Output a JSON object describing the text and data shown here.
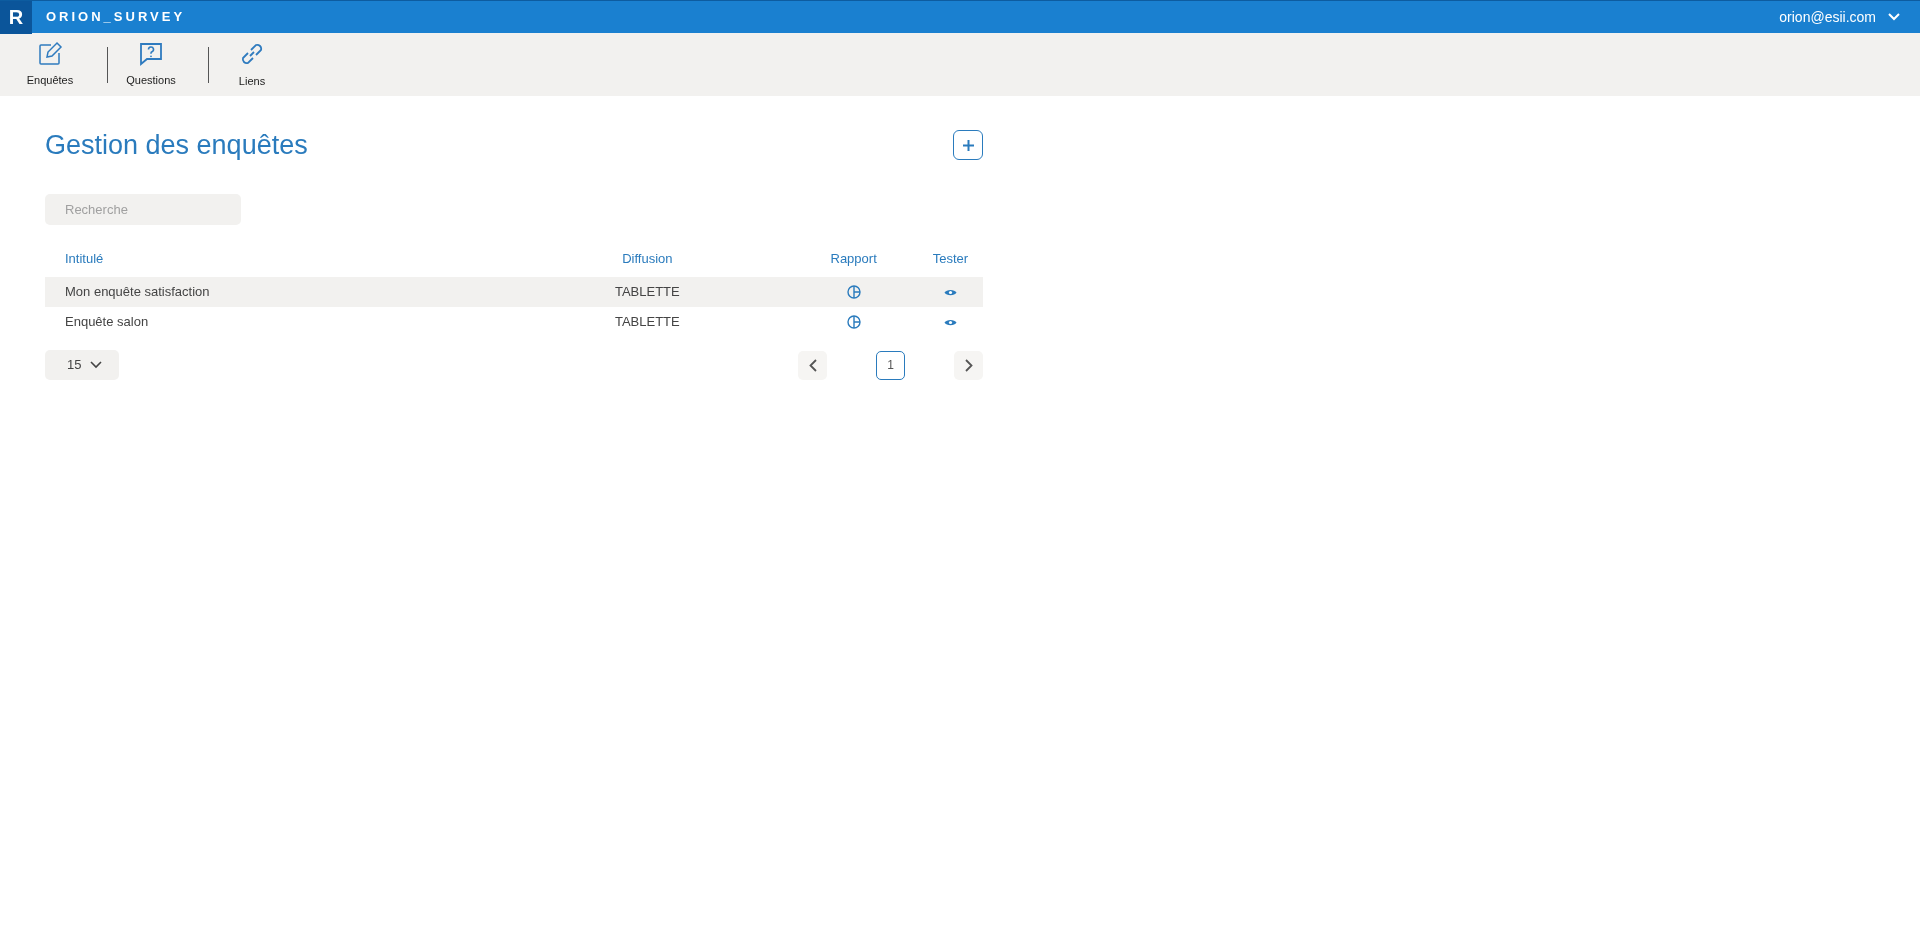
{
  "header": {
    "logo": "R",
    "brand": "ORION_SURVEY",
    "user": "orion@esii.com"
  },
  "toolbar": [
    {
      "label": "Enquêtes",
      "kind": "edit"
    },
    {
      "label": "Questions",
      "kind": "question"
    },
    {
      "label": "Liens",
      "kind": "link"
    }
  ],
  "page": {
    "title": "Gestion des enquêtes",
    "search": {
      "placeholder": "Recherche"
    }
  },
  "table": {
    "columns": [
      "Intitulé",
      "Diffusion",
      "Rapport",
      "Tester"
    ],
    "rows": [
      {
        "title": "Mon enquête satisfaction",
        "diffusion": "TABLETTE",
        "highlighted": true
      },
      {
        "title": "Enquête salon",
        "diffusion": "TABLETTE",
        "highlighted": false
      }
    ]
  },
  "pagination": {
    "page_size": "15",
    "pages": [
      {
        "label": "1",
        "selected": true
      }
    ]
  }
}
